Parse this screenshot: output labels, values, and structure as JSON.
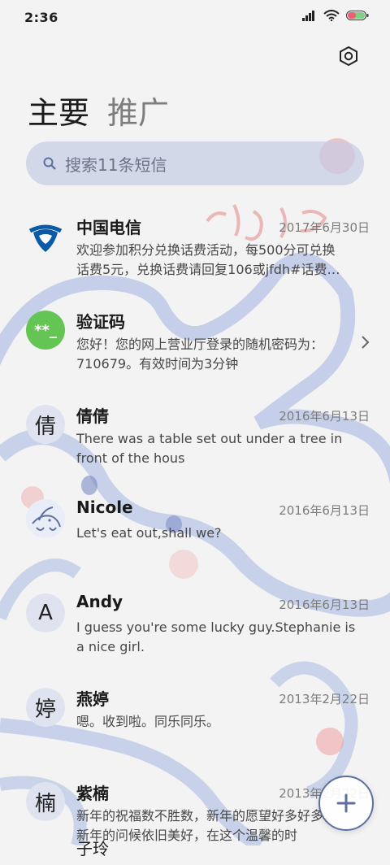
{
  "status": {
    "time": "2:36"
  },
  "tabs": {
    "main": "主要",
    "promotions": "推广"
  },
  "search": {
    "placeholder": "搜索11条短信"
  },
  "items": [
    {
      "name": "中国电信",
      "date": "2017年6月30日",
      "preview": "欢迎参加积分兑换话费活动，每500分可兑换\n话费5元，兑换话费请回复106或jfdh#话费…",
      "avatar_icon": "china-telecom-logo-icon"
    },
    {
      "name": "验证码",
      "date": "",
      "preview": "您好！您的网上营业厅登录的随机密码为：\n710679。有效时间为3分钟",
      "avatar_icon": "verification-code-icon",
      "avatar_text": "**_"
    },
    {
      "name": "倩倩",
      "date": "2016年6月13日",
      "preview": "There was a table set out under a tree in\nfront of the hous",
      "avatar_text": "倩"
    },
    {
      "name": "Nicole",
      "date": "2016年6月13日",
      "preview": "Let's eat out,shall we?",
      "avatar_icon": "bird-sketch-icon"
    },
    {
      "name": "Andy",
      "date": "2016年6月13日",
      "preview": "I guess you're some lucky guy.Stephanie is\na nice girl.",
      "avatar_text": "A"
    },
    {
      "name": "燕婷",
      "date": "2013年2月22日",
      "preview": "嗯。收到啦。同乐同乐。",
      "avatar_text": "婷"
    },
    {
      "name": "紫楠",
      "date": "2013年2月22日",
      "preview": "新年的祝福数不胜数，新年的愿望好多好多，\n新年的问候依旧美好，在这个温馨的时",
      "avatar_text": "楠"
    }
  ],
  "partial_item": {
    "name": "子玲"
  },
  "colors": {
    "accent": "#5e6f9f",
    "search_bg": "#c6cde4",
    "telecom_blue": "#0b5aa6",
    "code_green": "#64c554"
  }
}
